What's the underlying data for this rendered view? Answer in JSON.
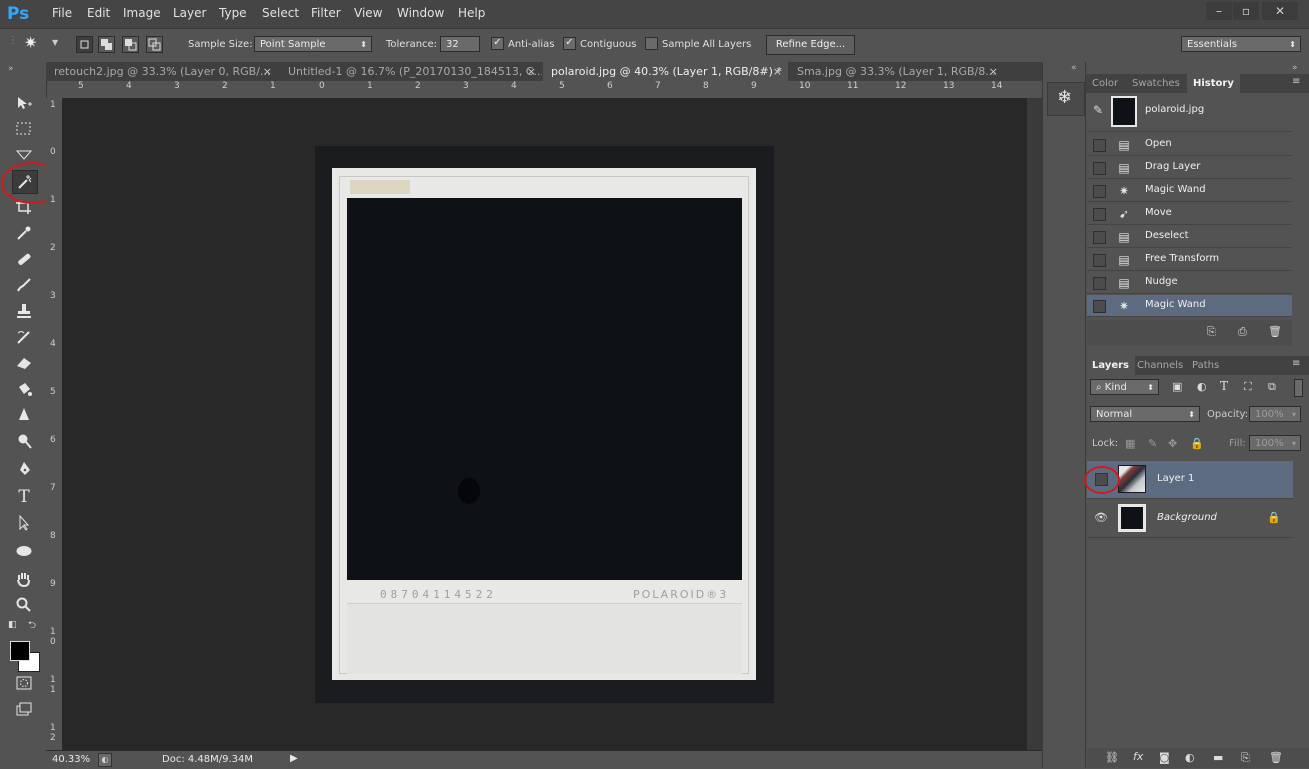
{
  "app": {
    "logo": "Ps"
  },
  "menu": [
    "File",
    "Edit",
    "Image",
    "Layer",
    "Type",
    "Select",
    "Filter",
    "View",
    "Window",
    "Help"
  ],
  "window_controls": [
    "–",
    "▫",
    "✕"
  ],
  "options": {
    "sample_size_label": "Sample Size:",
    "sample_size_value": "Point Sample",
    "tolerance_label": "Tolerance:",
    "tolerance_value": "32",
    "anti_alias": "Anti-alias",
    "contiguous": "Contiguous",
    "sample_all_layers": "Sample All Layers",
    "refine_edge": "Refine Edge...",
    "workspace": "Essentials"
  },
  "tabs": [
    {
      "label": "retouch2.jpg @ 33.3% (Layer 0, RGB/...",
      "close": "×",
      "active": false
    },
    {
      "label": "Untitled-1 @ 16.7% (P_20170130_184513, C...",
      "close": "×",
      "active": false
    },
    {
      "label": "polaroid.jpg @ 40.3% (Layer 1, RGB/8#) *",
      "close": "×",
      "active": true
    },
    {
      "label": "Sma.jpg @ 33.3% (Layer 1, RGB/8...",
      "close": "×",
      "active": false
    }
  ],
  "hruler": [
    "5",
    "4",
    "3",
    "2",
    "1",
    "0",
    "1",
    "2",
    "3",
    "4",
    "5",
    "6",
    "7",
    "8",
    "9",
    "10",
    "11",
    "12",
    "13",
    "14"
  ],
  "vruler": [
    "1",
    "0",
    "1",
    "2",
    "3",
    "4",
    "5",
    "6",
    "7",
    "8",
    "9",
    "1\n0",
    "1\n1",
    "1\n2"
  ],
  "photo": {
    "print_code": "08704114522",
    "brand": "POLAROID®3"
  },
  "status": {
    "zoom": "40.33%",
    "doc": "Doc: 4.48M/9.34M"
  },
  "history_panel": {
    "tabs": [
      "Color",
      "Swatches",
      "History"
    ],
    "snapshot": "polaroid.jpg",
    "items": [
      {
        "label": "Open",
        "icon": "document-icon"
      },
      {
        "label": "Drag Layer",
        "icon": "document-icon"
      },
      {
        "label": "Magic Wand",
        "icon": "magic-wand-icon"
      },
      {
        "label": "Move",
        "icon": "move-icon"
      },
      {
        "label": "Deselect",
        "icon": "document-icon"
      },
      {
        "label": "Free Transform",
        "icon": "document-icon"
      },
      {
        "label": "Nudge",
        "icon": "document-icon"
      },
      {
        "label": "Magic Wand",
        "icon": "magic-wand-icon"
      }
    ]
  },
  "layers_panel": {
    "tabs": [
      "Layers",
      "Channels",
      "Paths"
    ],
    "filter_kind": "Kind",
    "blend_mode": "Normal",
    "opacity_label": "Opacity:",
    "opacity_value": "100%",
    "lock_label": "Lock:",
    "fill_label": "Fill:",
    "fill_value": "100%",
    "layers": [
      {
        "name": "Layer 1",
        "visible": false,
        "selected": true
      },
      {
        "name": "Background",
        "visible": true,
        "selected": false,
        "locked": true
      }
    ]
  },
  "colors": {
    "accent_select": "#5d6b80",
    "annotation": "#d11a1a",
    "canvas_bg": "#282828"
  }
}
